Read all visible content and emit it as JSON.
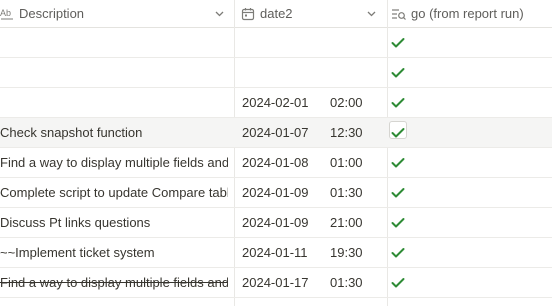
{
  "columns": {
    "description": "Description",
    "date": "date2",
    "go": "go (from report run)"
  },
  "rows": [
    {
      "description": "",
      "date": "",
      "time": "",
      "checked": true
    },
    {
      "description": "",
      "date": "",
      "time": "",
      "checked": true
    },
    {
      "description": "",
      "date": "2024-02-01",
      "time": "02:00",
      "checked": true
    },
    {
      "description": "Check snapshot function",
      "date": "2024-01-07",
      "time": "12:30",
      "checked": true
    },
    {
      "description": "Find a way to display multiple fields and ...",
      "date": "2024-01-08",
      "time": "01:00",
      "checked": true
    },
    {
      "description": "Complete script to update Compare tabl...",
      "date": "2024-01-09",
      "time": "01:30",
      "checked": true
    },
    {
      "description": "Discuss Pt links questions",
      "date": "2024-01-09",
      "time": "21:00",
      "checked": true
    },
    {
      "description": "~~Implement ticket system",
      "date": "2024-01-11",
      "time": "19:30",
      "checked": true
    },
    {
      "description": "Find a way to display multiple fields and...",
      "date": "2024-01-17",
      "time": "01:30",
      "checked": true
    }
  ],
  "colors": {
    "check": "#2e8b35",
    "header_text": "#5f5e5b",
    "border": "#e9e8e5"
  },
  "icons": {
    "description": "text-type-icon",
    "date": "calendar-icon",
    "go": "rollup-icon"
  }
}
